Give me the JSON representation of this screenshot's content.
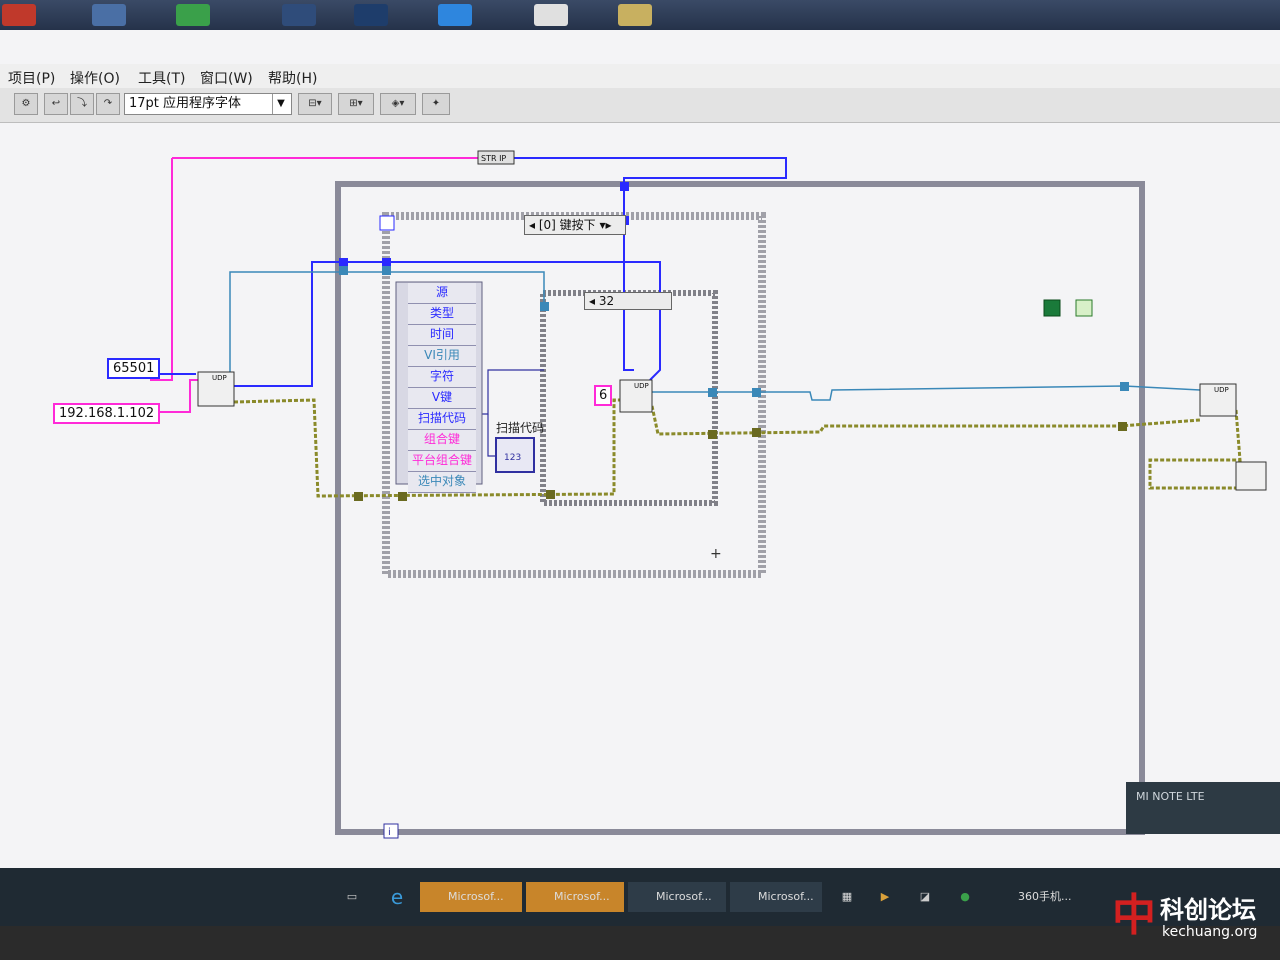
{
  "menu": {
    "items": [
      {
        "label": "项目(P)"
      },
      {
        "label": "操作(O)"
      },
      {
        "label": "工具(T)"
      },
      {
        "label": "窗口(W)"
      },
      {
        "label": "帮助(H)"
      }
    ]
  },
  "toolbar": {
    "font_select": "17pt 应用程序字体"
  },
  "diagram": {
    "constants": {
      "port": "65501",
      "ip": "192.168.1.102",
      "case_const": "6"
    },
    "event_selector": "[0] 键按下",
    "case_selector": "32",
    "str_ip_node": "STR IP",
    "event_data_items": [
      {
        "label": "源"
      },
      {
        "label": "类型"
      },
      {
        "label": "时间"
      },
      {
        "label": "VI引用"
      },
      {
        "label": "字符"
      },
      {
        "label": "V键"
      },
      {
        "label": "扫描代码"
      },
      {
        "label": "组合键"
      },
      {
        "label": "平台组合键"
      },
      {
        "label": "选中对象"
      }
    ],
    "scan_code_label": "扫描代码",
    "indicator_value": "123",
    "udp_label": "UDP",
    "loop_index": "i"
  },
  "taskbar": {
    "apps": [
      {
        "label": "Microsof..."
      },
      {
        "label": "Microsof..."
      },
      {
        "label": "Microsof..."
      },
      {
        "label": "Microsof..."
      },
      {
        "label": "360手机..."
      }
    ]
  },
  "notification": {
    "title": "MI NOTE LTE"
  },
  "watermark": {
    "title": "科创论坛",
    "url": "kechuang.org"
  },
  "colors": {
    "wire_pink": "#ff2ad8",
    "wire_blue": "#2a2aff",
    "wire_teal": "#3a88b8",
    "wire_olive": "#8a8a2a",
    "frame_gray": "#8a8a99"
  }
}
